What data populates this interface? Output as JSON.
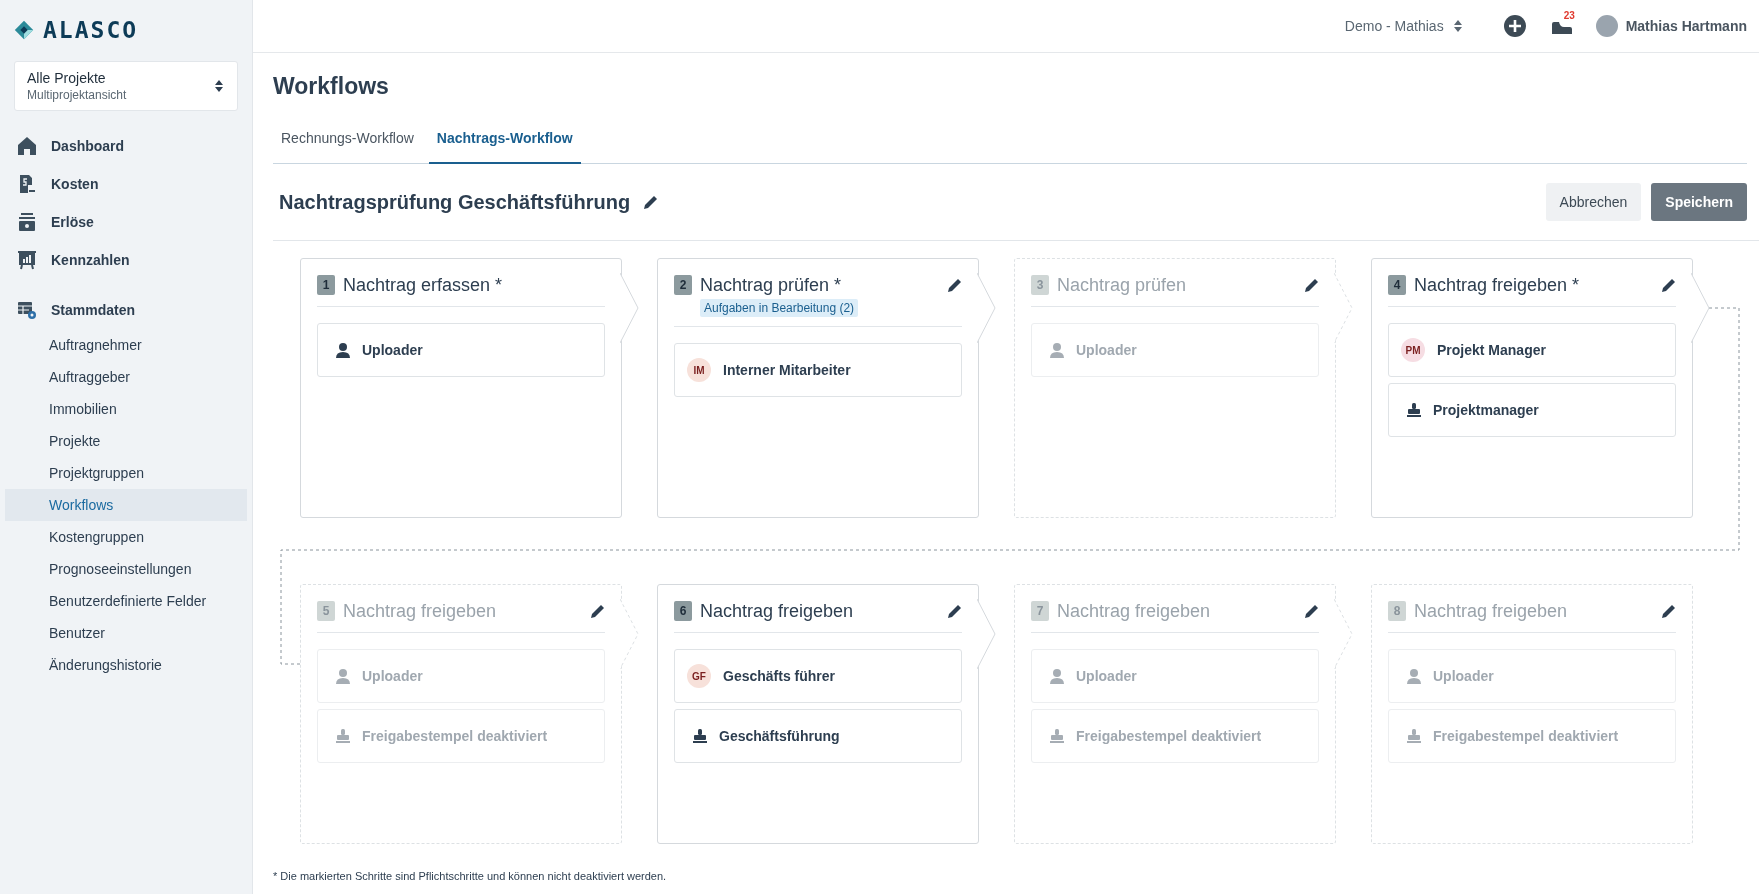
{
  "sidebar": {
    "logo": "ALASCO",
    "project_switcher": {
      "title": "Alle Projekte",
      "subtitle": "Multiprojektansicht"
    },
    "nav": [
      {
        "label": "Dashboard",
        "selected": false
      },
      {
        "label": "Kosten",
        "selected": false
      },
      {
        "label": "Erlöse",
        "selected": false
      },
      {
        "label": "Kennzahlen",
        "selected": false
      },
      {
        "label": "Stammdaten",
        "selected": false,
        "children": [
          {
            "label": "Auftragnehmer",
            "selected": false
          },
          {
            "label": "Auftraggeber",
            "selected": false
          },
          {
            "label": "Immobilien",
            "selected": false
          },
          {
            "label": "Projekte",
            "selected": false
          },
          {
            "label": "Projektgruppen",
            "selected": false
          },
          {
            "label": "Workflows",
            "selected": true
          },
          {
            "label": "Kostengruppen",
            "selected": false
          },
          {
            "label": "Prognoseeinstellungen",
            "selected": false
          },
          {
            "label": "Benutzerdefinierte Felder",
            "selected": false
          },
          {
            "label": "Benutzer",
            "selected": false
          },
          {
            "label": "Änderungshistorie",
            "selected": false
          }
        ]
      }
    ]
  },
  "header": {
    "account_switcher": "Demo - Mathias",
    "notification_count": "23",
    "user_name": "Mathias Hartmann"
  },
  "page": {
    "title": "Workflows",
    "tabs": [
      {
        "label": "Rechnungs-Workflow",
        "selected": false
      },
      {
        "label": "Nachtrags-Workflow",
        "selected": true
      }
    ],
    "workflow_name": "Nachtragsprüfung Geschäftsführung",
    "buttons": [
      {
        "label": "Abbrechen",
        "kind": "secondary"
      },
      {
        "label": "Speichern",
        "kind": "primary"
      }
    ],
    "steps": [
      {
        "number": "1",
        "title": "Nachtrag erfassen *",
        "active": true,
        "editable": false,
        "assignees": [
          {
            "kind": "user",
            "label": "Uploader"
          }
        ]
      },
      {
        "number": "2",
        "title": "Nachtrag prüfen *",
        "badge": "Aufgaben in Bearbeitung (2)",
        "active": true,
        "editable": true,
        "assignees": [
          {
            "kind": "avatar",
            "initials": "IM",
            "label": "Interner Mitarbeiter",
            "color": "#f7e1da"
          }
        ]
      },
      {
        "number": "3",
        "title": "Nachtrag prüfen",
        "active": false,
        "editable": true,
        "assignees": [
          {
            "kind": "user",
            "label": "Uploader"
          }
        ]
      },
      {
        "number": "4",
        "title": "Nachtrag freigeben *",
        "active": true,
        "editable": true,
        "assignees": [
          {
            "kind": "avatar",
            "initials": "PM",
            "label": "Projekt Manager",
            "color": "#f6dde3"
          },
          {
            "kind": "stamp",
            "label": "Projektmanager"
          }
        ]
      },
      {
        "number": "5",
        "title": "Nachtrag freigeben",
        "active": false,
        "editable": true,
        "assignees": [
          {
            "kind": "user",
            "label": "Uploader"
          },
          {
            "kind": "stamp",
            "label": "Freigabestempel deaktiviert"
          }
        ]
      },
      {
        "number": "6",
        "title": "Nachtrag freigeben",
        "active": true,
        "editable": true,
        "assignees": [
          {
            "kind": "avatar",
            "initials": "GF",
            "label": "Geschäfts führer",
            "color": "#f7e1da"
          },
          {
            "kind": "stamp",
            "label": "Geschäftsführung"
          }
        ]
      },
      {
        "number": "7",
        "title": "Nachtrag freigeben",
        "active": false,
        "editable": true,
        "assignees": [
          {
            "kind": "user",
            "label": "Uploader"
          },
          {
            "kind": "stamp",
            "label": "Freigabestempel deaktiviert"
          }
        ]
      },
      {
        "number": "8",
        "title": "Nachtrag freigeben",
        "active": false,
        "editable": true,
        "assignees": [
          {
            "kind": "user",
            "label": "Uploader"
          },
          {
            "kind": "stamp",
            "label": "Freigabestempel deaktiviert"
          }
        ]
      }
    ],
    "footnote": "* Die markierten Schritte sind Pflichtschritte und können nicht deaktiviert werden."
  }
}
